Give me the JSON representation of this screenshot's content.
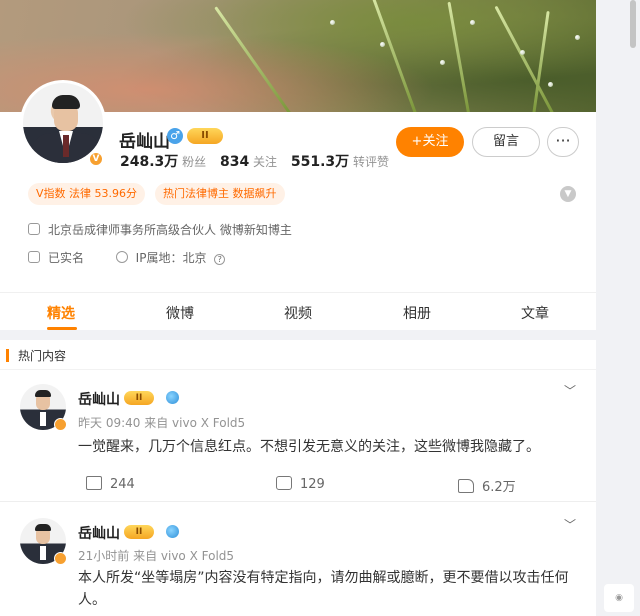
{
  "profile": {
    "name": "岳屾山",
    "gender_icon": "male-symbol",
    "vip_label": "II",
    "avatar_badge": "V",
    "stats": {
      "followers_value": "248.3万",
      "followers_label": "粉丝",
      "following_value": "834",
      "following_label": "关注",
      "reposts_value": "551.3万",
      "reposts_label": "转评赞"
    },
    "follow_button": "+关注",
    "message_button": "留言",
    "more_button": "···",
    "tags": [
      "V指数 法律 53.96分",
      "热门法律博主 数据飙升"
    ],
    "info": {
      "description": "北京岳成律师事务所高级合伙人 微博新知博主",
      "verified": "已实名",
      "ip_location": "IP属地：北京"
    },
    "collapse_icon": "chevron-down"
  },
  "tabs": [
    "精选",
    "微博",
    "视频",
    "相册",
    "文章"
  ],
  "active_tab": "精选",
  "feed": {
    "section_title": "热门内容",
    "posts": [
      {
        "author": "岳屾山",
        "vip": "II",
        "meta": "昨天 09:40 来自 vivo X Fold5",
        "text": "一觉醒来，几万个信息红点。不想引发无意义的关注，这些微博我隐藏了。",
        "reposts": "244",
        "comments": "129",
        "likes": "6.2万"
      },
      {
        "author": "岳屾山",
        "vip": "II",
        "meta": "21小时前 来自 vivo X Fold5",
        "text": "本人所发“坐等塌房”内容没有特定指向，请勿曲解或臆断，更不要借以攻击任何人。"
      }
    ]
  },
  "colors": {
    "accent": "#ff8200",
    "tag_bg": "#fff1e6",
    "tag_text": "#ff6a00"
  }
}
